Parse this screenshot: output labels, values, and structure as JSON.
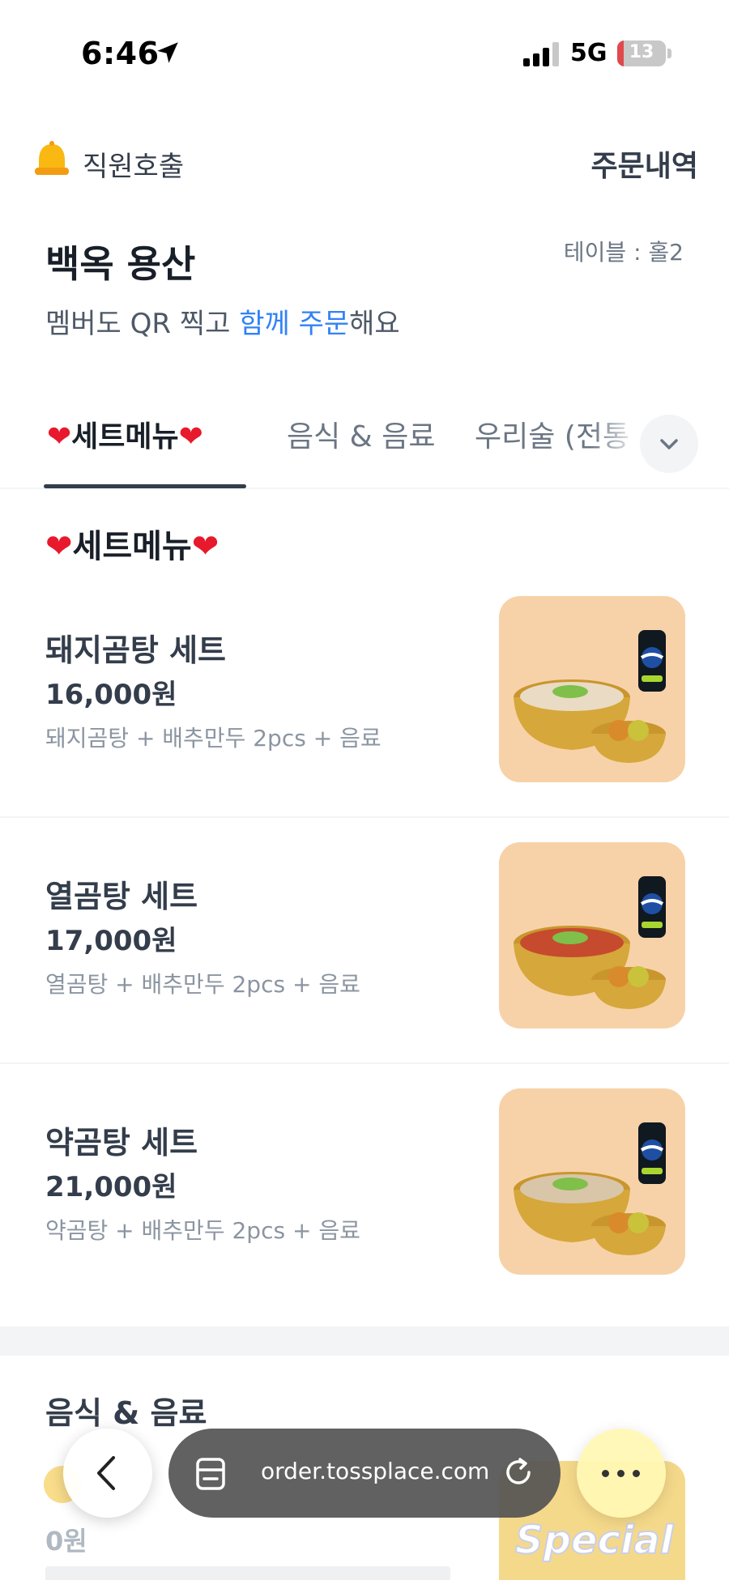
{
  "status_bar": {
    "time": "6:46",
    "network": "5G",
    "battery_level": "13",
    "battery_fraction": 0.13
  },
  "header": {
    "call_staff": "직원호출",
    "order_history": "주문내역",
    "store_name": "백옥 용산",
    "table_label": "테이블 : 홀2",
    "subtitle_prefix": "멤버도 QR 찍고 ",
    "subtitle_highlight": "함께 주문",
    "subtitle_suffix": "해요"
  },
  "tabs": [
    {
      "label": "세트메뉴"
    },
    {
      "label": "음식 & 음료"
    },
    {
      "label": "우리술 (전통"
    }
  ],
  "sections": {
    "set_menu_title": "세트메뉴",
    "food_drink_title": "음식 & 음료"
  },
  "menu_items": [
    {
      "name": "돼지곰탕 세트",
      "price": "16,000원",
      "desc": "돼지곰탕 + 배추만두 2pcs + 음료",
      "soup_color": "#eadbc4"
    },
    {
      "name": "열곰탕 세트",
      "price": "17,000원",
      "desc": "열곰탕 + 배추만두 2pcs + 음료",
      "soup_color": "#c64a2e"
    },
    {
      "name": "약곰탕 세트",
      "price": "21,000원",
      "desc": "약곰탕 + 배추만두 2pcs + 음료",
      "soup_color": "#d9c6a8"
    }
  ],
  "partial_item": {
    "price": "0원",
    "image_text": "Special"
  },
  "browser": {
    "url": "order.tossplace.com"
  },
  "colors": {
    "accent": "#3182f6",
    "heart": "#e8192c",
    "photo_bg": "#f7d2a8"
  }
}
